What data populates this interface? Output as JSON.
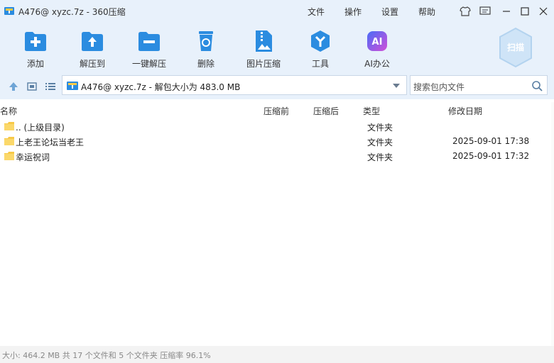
{
  "window": {
    "title": "A476@ xyzc.7z - 360压缩"
  },
  "menu": {
    "file": "文件",
    "operate": "操作",
    "settings": "设置",
    "help": "帮助"
  },
  "toolbar": {
    "add": "添加",
    "extract_to": "解压到",
    "one_click": "一键解压",
    "delete": "删除",
    "image_compress": "图片压缩",
    "tools": "工具",
    "ai_office": "AI办公",
    "scan": "扫描",
    "ai_badge": "AI"
  },
  "path": {
    "text": "A476@ xyzc.7z - 解包大小为 483.0 MB"
  },
  "search": {
    "placeholder": "搜索包内文件"
  },
  "columns": {
    "name": "名称",
    "compressed_before": "压缩前",
    "compressed_after": "压缩后",
    "type": "类型",
    "modified": "修改日期"
  },
  "rows": [
    {
      "name": ".. (上级目录)",
      "before": "",
      "after": "",
      "type": "文件夹",
      "modified": ""
    },
    {
      "name": "上老王论坛当老王",
      "before": "",
      "after": "",
      "type": "文件夹",
      "modified": "2025-09-01 17:38"
    },
    {
      "name": "幸运祝词",
      "before": "",
      "after": "",
      "type": "文件夹",
      "modified": "2025-09-01 17:32"
    }
  ],
  "status": {
    "text": "大小: 464.2 MB 共 17 个文件和 5 个文件夹 压缩率 96.1%"
  },
  "colors": {
    "accent": "#2b8ce0",
    "chrome": "#e8f1fb",
    "folder": "#f7c948"
  }
}
